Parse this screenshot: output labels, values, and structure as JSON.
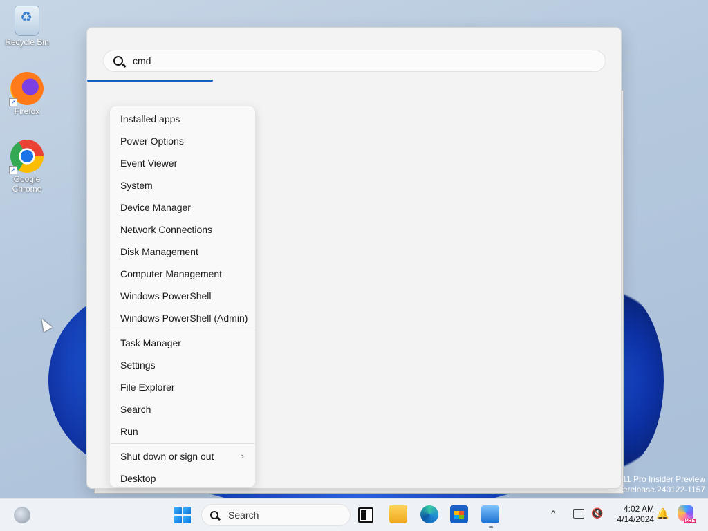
{
  "desktop": {
    "icons": [
      {
        "label": "Recycle Bin"
      },
      {
        "label": "Firefox"
      },
      {
        "label": "Google Chrome"
      }
    ],
    "watermark": {
      "line1": "11 Pro Insider Preview",
      "line2": "rerelease.240122-1157"
    }
  },
  "search_panel": {
    "query": "cmd"
  },
  "context_menu": {
    "group1": [
      "Installed apps",
      "Power Options",
      "Event Viewer",
      "System",
      "Device Manager",
      "Network Connections",
      "Disk Management",
      "Computer Management",
      "Windows PowerShell",
      "Windows PowerShell (Admin)"
    ],
    "group2": [
      "Task Manager",
      "Settings",
      "File Explorer",
      "Search",
      "Run"
    ],
    "group3": [
      "Shut down or sign out",
      "Desktop"
    ]
  },
  "taskbar": {
    "search_label": "Search",
    "time": "4:02 AM",
    "date": "4/14/2024",
    "copilot_badge": "PRE"
  },
  "colors": {
    "accent": "#0f5fc4"
  }
}
